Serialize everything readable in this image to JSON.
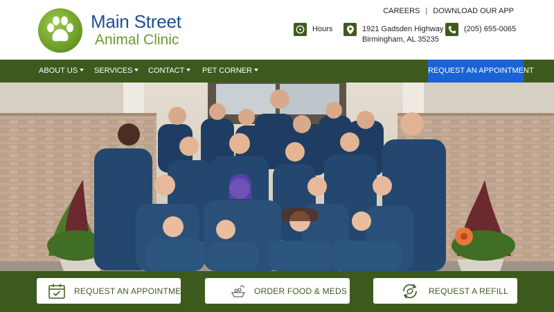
{
  "brand": {
    "name_line1": "Main Street",
    "name_line2": "Animal Clinic",
    "logo_icon": "paw-print-icon",
    "colors": {
      "green": "#3d5a1e",
      "blue": "#1f4f8f",
      "light_green": "#6b9a2c",
      "cta_blue": "#1a63d6"
    }
  },
  "toplinks": {
    "careers": "CAREERS",
    "separator": "|",
    "download_app": "DOWNLOAD OUR APP"
  },
  "info": {
    "hours": {
      "icon": "clock-icon",
      "label": "Hours"
    },
    "address": {
      "icon": "map-pin-icon",
      "line1": "1921 Gadsden Highway",
      "line2": "Birmingham, AL 35235"
    },
    "phone": {
      "icon": "phone-icon",
      "label": "(205) 655-0065"
    }
  },
  "nav": {
    "items": [
      {
        "label": "ABOUT US"
      },
      {
        "label": "SERVICES"
      },
      {
        "label": "CONTACT"
      },
      {
        "label": "PET CORNER"
      }
    ],
    "cta": "REQUEST AN APPOINTMENT"
  },
  "hero": {
    "image": "clinic-staff-team-photo"
  },
  "actions": [
    {
      "icon": "calendar-check-icon",
      "label": "REQUEST AN APPOINTMENT"
    },
    {
      "icon": "pet-food-bowl-icon",
      "label": "ORDER FOOD & MEDS"
    },
    {
      "icon": "refill-pill-icon",
      "label": "REQUEST A REFILL"
    }
  ]
}
